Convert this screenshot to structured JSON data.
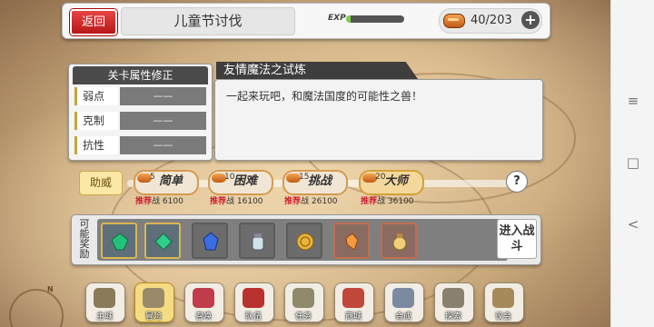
{
  "top_bar": {
    "back_label": "返回",
    "stage_title": "儿童节讨伐",
    "exp_label": "EXP",
    "exp_progress": 0.08,
    "stamina": "40/203",
    "plus_glyph": "+"
  },
  "attributes": {
    "title": "关卡属性修正",
    "rows": [
      {
        "name": "弱点",
        "value": "——"
      },
      {
        "name": "克制",
        "value": "——"
      },
      {
        "name": "抗性",
        "value": "——"
      }
    ]
  },
  "description": {
    "title": "友情魔法之试炼",
    "text": "一起来玩吧，和魔法国度的可能性之兽！"
  },
  "difficulty": {
    "assist_label": "助威",
    "help_glyph": "?",
    "recommend_tag": "推荐",
    "combat_tag": "战",
    "levels": [
      {
        "cost": "5",
        "name": "简单",
        "power": "6100",
        "active": false
      },
      {
        "cost": "10",
        "name": "困难",
        "power": "16100",
        "active": false
      },
      {
        "cost": "15",
        "name": "挑战",
        "power": "26100",
        "active": false
      },
      {
        "cost": "20",
        "name": "大师",
        "power": "36100",
        "active": true
      }
    ]
  },
  "rewards": {
    "label": "可能奖励",
    "items": [
      {
        "icon": "green-crystal-icon",
        "frame": "gold"
      },
      {
        "icon": "green-crystal-icon",
        "frame": "gold"
      },
      {
        "icon": "blue-crystal-icon",
        "frame": "plain"
      },
      {
        "icon": "potion-jar-icon",
        "frame": "plain"
      },
      {
        "icon": "gold-coin-icon",
        "frame": "plain"
      },
      {
        "icon": "orange-shard-icon",
        "frame": "red"
      },
      {
        "icon": "sand-bottle-icon",
        "frame": "red"
      }
    ],
    "enter_battle_label": "进入战斗"
  },
  "bottom_menu": [
    {
      "label": "主城",
      "icon": "castle-icon",
      "active": false
    },
    {
      "label": "冒险",
      "icon": "sword-icon",
      "active": true
    },
    {
      "label": "召唤",
      "icon": "summon-icon",
      "active": false
    },
    {
      "label": "队伍",
      "icon": "team-icon",
      "active": false
    },
    {
      "label": "任务",
      "icon": "quest-icon",
      "active": false
    },
    {
      "label": "商城",
      "icon": "shop-icon",
      "active": false
    },
    {
      "label": "合成",
      "icon": "craft-icon",
      "active": false
    },
    {
      "label": "探索",
      "icon": "explore-icon",
      "active": false
    },
    {
      "label": "议会",
      "icon": "council-icon",
      "active": false
    }
  ],
  "system_nav": {
    "menu_glyph": "≡",
    "home_glyph": "□",
    "back_glyph": "<"
  },
  "colors": {
    "back_button": "#d42a2a",
    "exp_fill": "#7fd14a",
    "assist_button": "#fbe8a7",
    "active_menu": "#f5dc82"
  }
}
